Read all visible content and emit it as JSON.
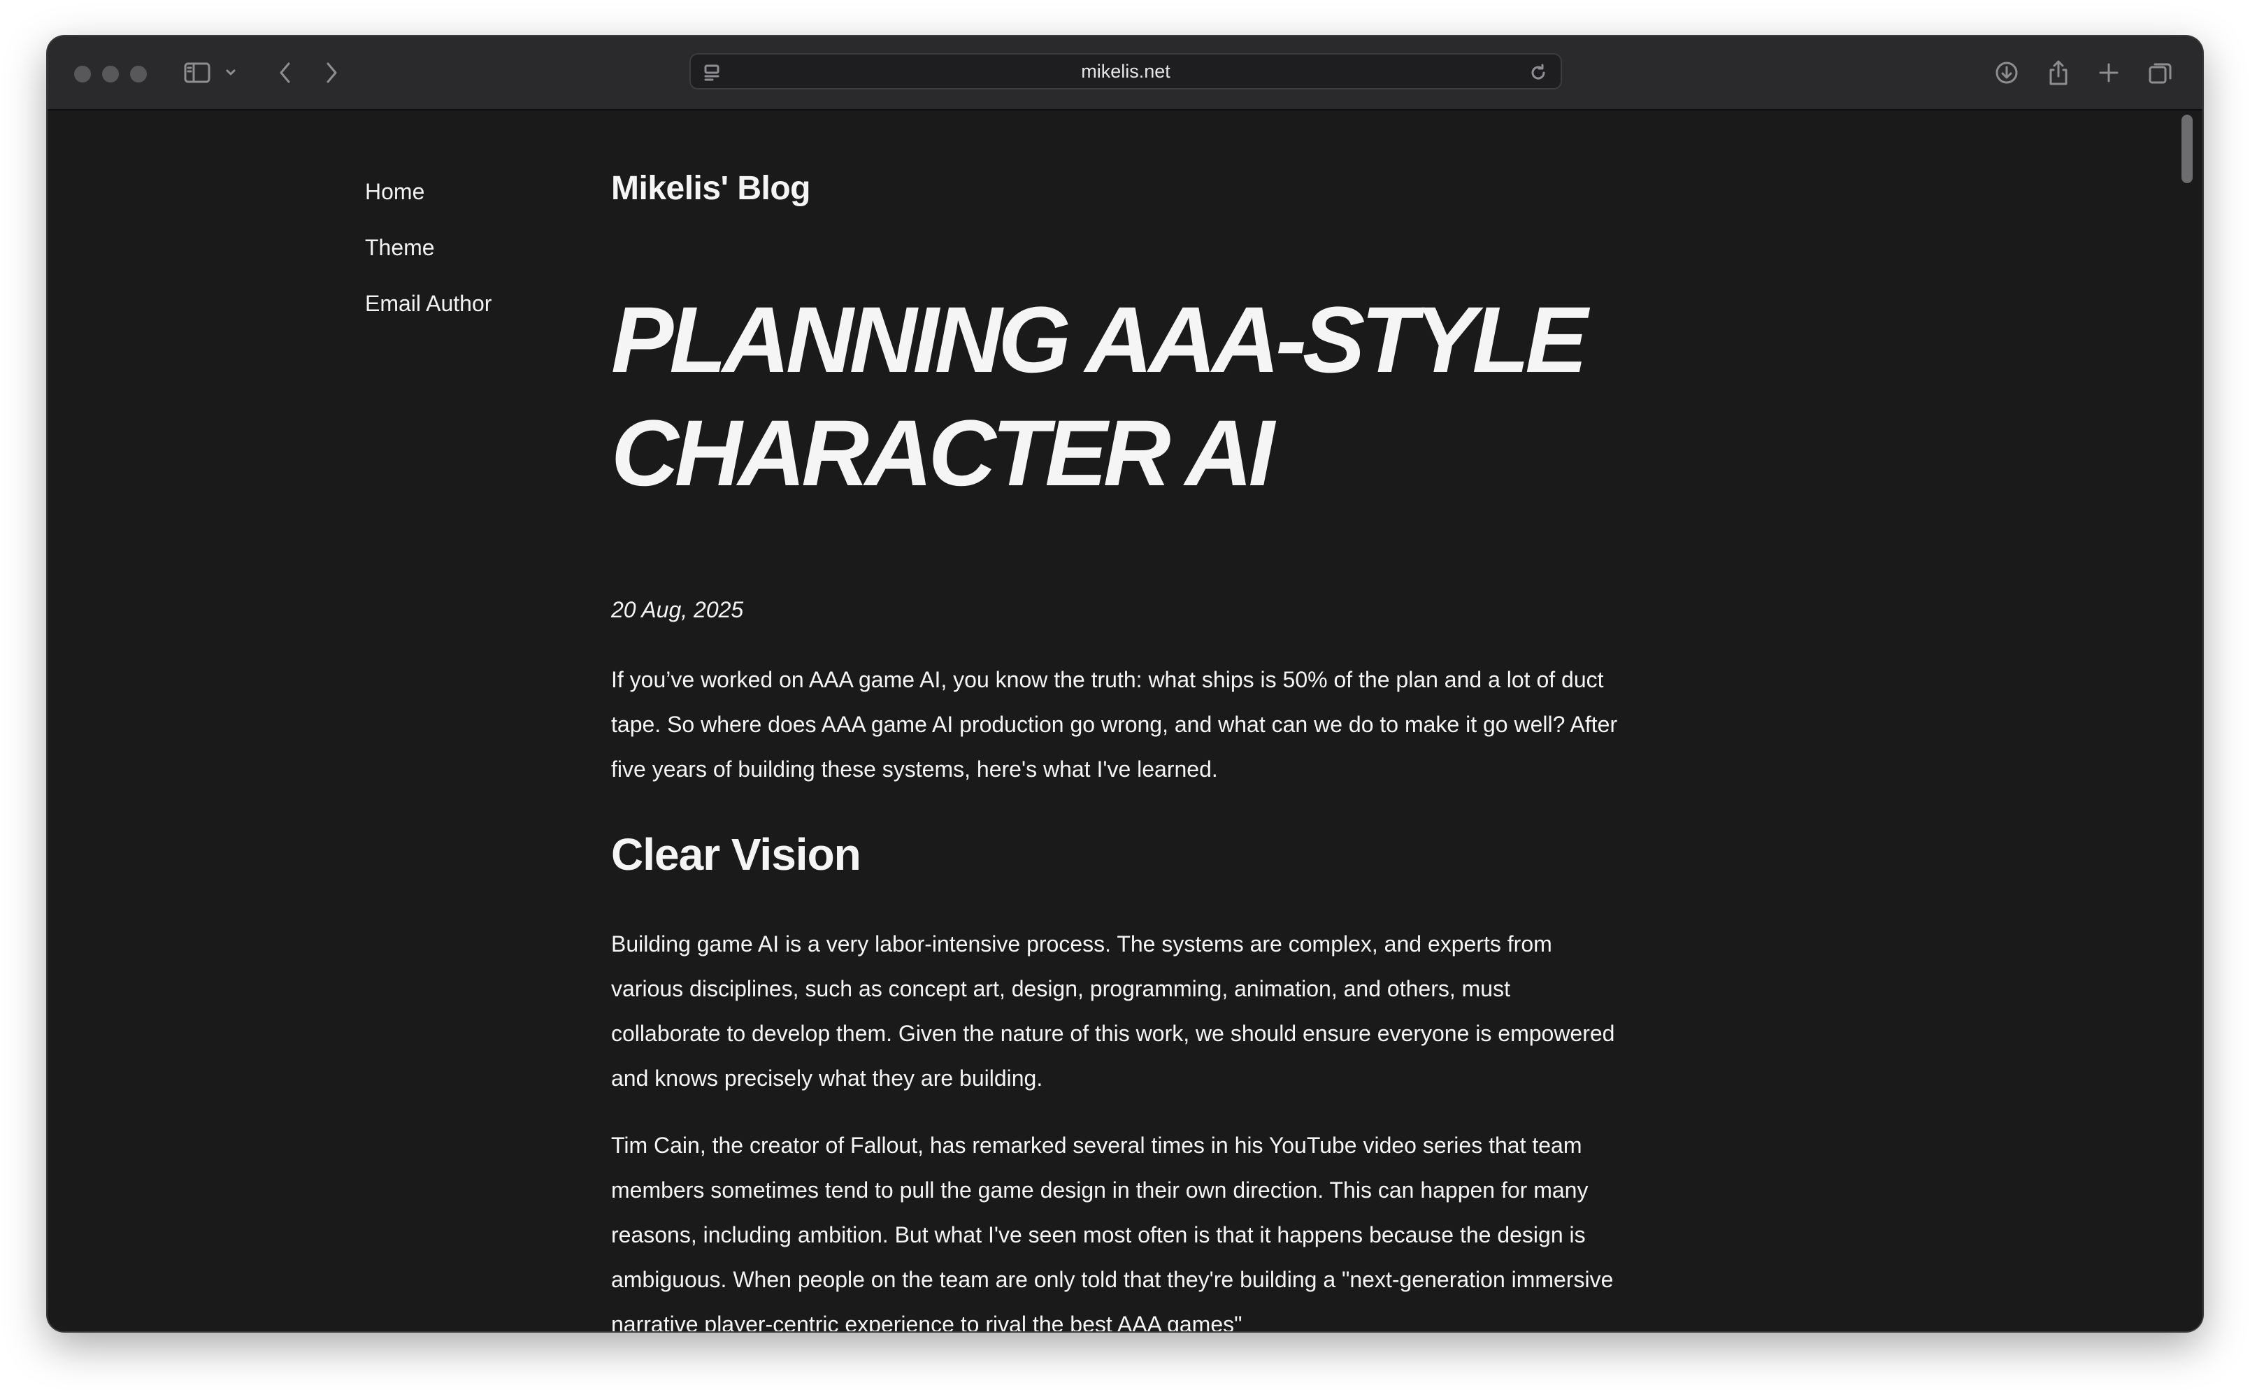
{
  "browser": {
    "url": "mikelis.net",
    "colors": {
      "chrome": "#2a2a2c",
      "page_bg": "#1a1a1b",
      "text": "#f5f5f5"
    },
    "icons": [
      "sidebar-icon",
      "chevron-down-icon",
      "back-icon",
      "forward-icon",
      "page-icon",
      "reload-icon",
      "download-icon",
      "share-icon",
      "new-tab-icon",
      "tabs-overview-icon"
    ]
  },
  "nav": {
    "items": [
      {
        "label": "Home"
      },
      {
        "label": "Theme"
      },
      {
        "label": "Email Author"
      }
    ]
  },
  "blog": {
    "title": "Mikelis' Blog"
  },
  "post": {
    "title": "Planning AAA-Style Character AI",
    "date": "20 Aug, 2025",
    "intro": "If you’ve worked on AAA game AI, you know the truth: what ships is 50% of the plan and a lot of duct tape. So where does AAA game AI production go wrong, and what can we do to make it go well? After five years of building these systems, here's what I've learned.",
    "section_heading": "Clear Vision",
    "paragraph_1": "Building game AI is a very labor-intensive process. The systems are complex, and experts from various disciplines, such as concept art, design, programming, animation, and others, must collaborate to develop them. Given the nature of this work, we should ensure everyone is empowered and knows precisely what they are building.",
    "paragraph_2": "Tim Cain, the creator of Fallout, has remarked several times in his YouTube video series that team members sometimes tend to pull the game design in their own direction. This can happen for many reasons, including ambition. But what I've seen most often is that it happens because the design is ambiguous. When people on the team are only told that they're building a \"next-generation immersive narrative player-centric experience to rival the best AAA games\""
  }
}
